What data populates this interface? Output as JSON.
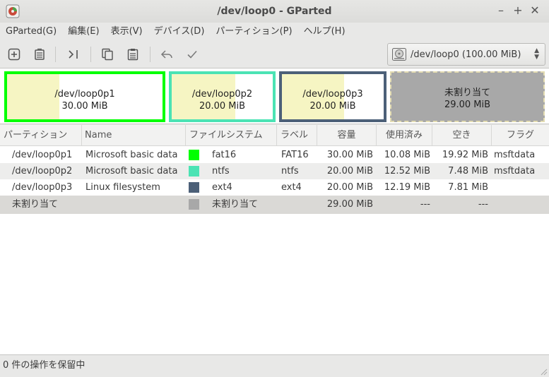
{
  "window": {
    "title": "/dev/loop0 - GParted"
  },
  "menu": [
    "GParted(G)",
    "編集(E)",
    "表示(V)",
    "デバイス(D)",
    "パーティション(P)",
    "ヘルプ(H)"
  ],
  "device": {
    "selected": "/dev/loop0  (100.00 MiB)"
  },
  "map": [
    {
      "name": "/dev/loop0p1",
      "size": "30.00 MiB",
      "color": "#00ff00",
      "used_fraction": 0.337
    },
    {
      "name": "/dev/loop0p2",
      "size": "20.00 MiB",
      "color": "#4be3b4",
      "used_fraction": 0.626
    },
    {
      "name": "/dev/loop0p3",
      "size": "20.00 MiB",
      "color": "#4c6078",
      "used_fraction": 0.61
    },
    {
      "name": "未割り当て",
      "size": "29.00 MiB",
      "color": "#a8a8a8",
      "used_fraction": 0
    }
  ],
  "table": {
    "headers": [
      "パーティション",
      "Name",
      "ファイルシステム",
      "ラベル",
      "容量",
      "使用済み",
      "空き",
      "フラグ"
    ],
    "rows": [
      {
        "partition": "/dev/loop0p1",
        "name": "Microsoft basic data",
        "fs_color": "#00ff00",
        "fs": "fat16",
        "label": "FAT16",
        "size": "30.00 MiB",
        "used": "10.08 MiB",
        "free": "19.92 MiB",
        "flags": "msftdata"
      },
      {
        "partition": "/dev/loop0p2",
        "name": "Microsoft basic data",
        "fs_color": "#4be3b4",
        "fs": "ntfs",
        "label": "ntfs",
        "size": "20.00 MiB",
        "used": "12.52 MiB",
        "free": "7.48 MiB",
        "flags": "msftdata"
      },
      {
        "partition": "/dev/loop0p3",
        "name": "Linux filesystem",
        "fs_color": "#4c6078",
        "fs": "ext4",
        "label": "ext4",
        "size": "20.00 MiB",
        "used": "12.19 MiB",
        "free": "7.81 MiB",
        "flags": ""
      },
      {
        "partition": "未割り当て",
        "name": "",
        "fs_color": "#a8a8a8",
        "fs": "未割り当て",
        "label": "",
        "size": "29.00 MiB",
        "used": "---",
        "free": "---",
        "flags": ""
      }
    ]
  },
  "status": {
    "text": "0 件の操作を保留中"
  }
}
